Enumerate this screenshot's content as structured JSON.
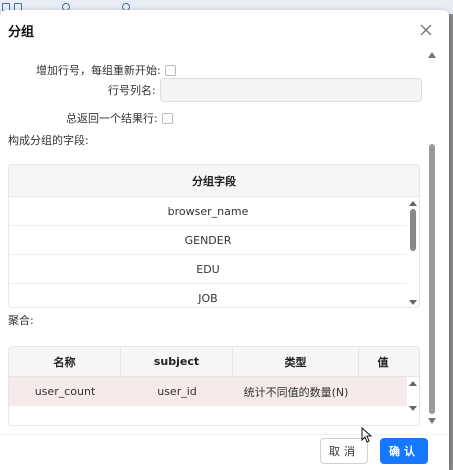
{
  "dialog": {
    "title": "分组",
    "close_icon": "close-icon"
  },
  "form": {
    "add_row_number_label": "增加行号，每组重新开始:",
    "row_number_name_label": "行号列名:",
    "row_number_name_value": "",
    "always_one_result_label": "总返回一个结果行:"
  },
  "group_fields": {
    "section_label": "构成分组的字段:",
    "header": "分组字段",
    "rows": [
      "browser_name",
      "GENDER",
      "EDU",
      "JOB"
    ]
  },
  "aggregation": {
    "section_label": "聚合:",
    "headers": [
      "名称",
      "subject",
      "类型",
      "值"
    ],
    "rows": [
      [
        "user_count",
        "user_id",
        "统计不同值的数量(N)",
        ""
      ]
    ],
    "selected_row_color": "#f5e9e9"
  },
  "footer": {
    "cancel_label": "取消",
    "ok_label": "确认"
  },
  "colors": {
    "primary": "#1677ff"
  }
}
